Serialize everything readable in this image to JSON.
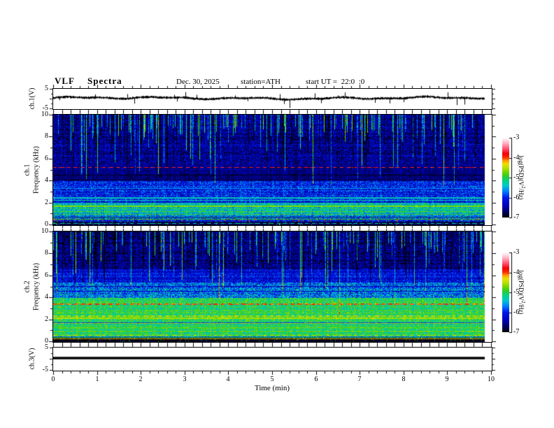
{
  "header": {
    "title": "VLF  Spectra",
    "date": "Dec. 30, 2025",
    "station": "station=ATH",
    "start_ut": "start UT =  22:0  :0"
  },
  "axes": {
    "time": {
      "label": "Time  (min)",
      "min": 0,
      "max": 10,
      "major_ticks": [
        0,
        1,
        2,
        3,
        4,
        5,
        6,
        7,
        8,
        9,
        10
      ],
      "minor_step": 0.2,
      "data_end_min": 9.85
    },
    "wave1": {
      "label": "ch.1(V)",
      "min": -5,
      "max": 5,
      "tick_labels": [
        5,
        -5
      ]
    },
    "spec1": {
      "label_channel": "ch.1",
      "label_axis": "Frequency  (kHz)",
      "min": 0,
      "max": 10,
      "tick_labels": [
        10,
        8,
        6,
        4,
        2,
        0
      ]
    },
    "spec2": {
      "label_channel": "ch.2",
      "label_axis": "Frequency  (kHz)",
      "min": 0,
      "max": 10,
      "tick_labels": [
        10,
        8,
        6,
        4,
        2,
        0
      ]
    },
    "wave3": {
      "label": "ch.3(V)",
      "min": -5,
      "max": 5,
      "tick_labels": [
        5,
        -5
      ]
    }
  },
  "colorbar": {
    "label_prefix": "log(PSD)(V",
    "label_sup": "2",
    "label_suffix": "/Hz)",
    "min": -7,
    "max": -3,
    "tick_labels": [
      -3,
      -4,
      -5,
      -6,
      -7
    ],
    "stops": [
      [
        0,
        "#000000"
      ],
      [
        0.07,
        "#00005e"
      ],
      [
        0.15,
        "#0000bb"
      ],
      [
        0.25,
        "#0018e8"
      ],
      [
        0.33,
        "#0080ff"
      ],
      [
        0.4,
        "#00c8cc"
      ],
      [
        0.46,
        "#00d284"
      ],
      [
        0.52,
        "#30cc2a"
      ],
      [
        0.56,
        "#66d400"
      ],
      [
        0.62,
        "#b4e000"
      ],
      [
        0.67,
        "#ecdf00"
      ],
      [
        0.71,
        "#ffa000"
      ],
      [
        0.75,
        "#ff3000"
      ],
      [
        0.8,
        "#f00000"
      ],
      [
        0.86,
        "#ff4e6e"
      ],
      [
        0.93,
        "#ffb0c2"
      ],
      [
        1,
        "#ffffff"
      ]
    ]
  },
  "chart_data": [
    {
      "type": "line",
      "panel": "ch1_waveform",
      "ylabel": "ch.1(V)",
      "ylim": [
        -5,
        5
      ],
      "xlim": [
        0,
        10
      ],
      "x_extent": [
        0,
        9.85
      ],
      "summary": "Continuous noisy broadband voltage trace centered near +0.4 V with dense fuzz of ±1 V and sparse impulsive spikes reaching about -4.5 V and +3 V.",
      "gen": {
        "base": 0.4,
        "fuzz": 0.5,
        "spike_p": 0.022,
        "seed": 7
      }
    },
    {
      "type": "heatmap",
      "panel": "ch1_spectrogram",
      "ylabel": "ch.1 Frequency (kHz)",
      "ylim": [
        0,
        10
      ],
      "xlim": [
        0,
        10
      ],
      "zlabel": "log(PSD)(V2/Hz)",
      "zlim": [
        -7,
        -3
      ],
      "summary": "VLF spectrogram: dark-blue 5.5-10 kHz band crossed by dense bright cyan-green vertical sferic streaks; very dark band 4-5.5 kHz with a faint purple-red line near 5.25 kHz; blue with cyan speckle 2-4 kHz; green-cyan horizontal banding below 2 kHz; black band below 0.3 kHz.",
      "gen": {
        "seed": 11,
        "bright_p": 0.22,
        "dark_p": 0.18,
        "row_noise": 0.13,
        "bands": [
          [
            5.5,
            10.01,
            -6.5,
            0.45
          ],
          [
            4.0,
            5.5,
            -6.6,
            0.3
          ],
          [
            2.0,
            4.0,
            -6.05,
            0.5
          ],
          [
            1.1,
            2.0,
            -5.3,
            0.45
          ],
          [
            0.6,
            1.1,
            -5.55,
            0.5
          ],
          [
            0.3,
            0.6,
            -6.1,
            0.6,
            0.05,
            -3.9
          ],
          [
            -0.01,
            0.3,
            -6.85,
            0.3,
            0.03,
            -5.0
          ]
        ],
        "lines": [
          [
            5.25,
            -3.8,
            1,
            1
          ],
          [
            4.55,
            -6.9,
            1
          ],
          [
            4.15,
            -6.85,
            1
          ],
          [
            3.3,
            -5.6,
            1
          ],
          [
            2.45,
            -5.35,
            2
          ],
          [
            2.2,
            -5.3,
            1
          ],
          [
            1.7,
            -4.7,
            2
          ],
          [
            1.45,
            -5.0,
            1
          ],
          [
            1.2,
            -4.9,
            1
          ],
          [
            0.95,
            -4.9,
            1
          ],
          [
            0.72,
            -6.6,
            1
          ],
          [
            0.5,
            -4.9,
            1
          ],
          [
            0.15,
            -5.2,
            1,
            1
          ]
        ]
      }
    },
    {
      "type": "heatmap",
      "panel": "ch2_spectrogram",
      "ylabel": "ch.2 Frequency (kHz)",
      "ylim": [
        0,
        10
      ],
      "xlim": [
        0,
        10
      ],
      "zlabel": "log(PSD)(V2/Hz)",
      "zlim": [
        -7,
        -3
      ],
      "summary": "VLF spectrogram: dark-blue 6.6-10 kHz band with cyan sferic streaks; blue 5.4-6.6 kHz; mixed blue-green 4-5.4 kHz; bright green below 4 kHz with a red dashed line near 3.4 kHz, yellow bands near 2.2 kHz and 0.6-1 kHz, dark olive lines, thin red line near 0.25 kHz over a black bottom band.",
      "gen": {
        "seed": 23,
        "bright_p": 0.18,
        "dark_p": 0.15,
        "row_noise": 0.14,
        "bands": [
          [
            6.6,
            10.01,
            -6.6,
            0.45
          ],
          [
            5.4,
            6.6,
            -6.15,
            0.4
          ],
          [
            4.0,
            5.4,
            -5.7,
            0.55,
            0.03,
            -6.8
          ],
          [
            0.35,
            4.0,
            -5.05,
            0.4
          ],
          [
            -0.01,
            0.35,
            -6.9,
            0.25,
            0.02,
            -5.0
          ]
        ],
        "lines": [
          [
            5.05,
            -6.4,
            1
          ],
          [
            4.6,
            -6.3,
            1
          ],
          [
            3.42,
            -4.0,
            2,
            1
          ],
          [
            2.8,
            -4.8,
            1
          ],
          [
            2.3,
            -4.5,
            2,
            1
          ],
          [
            2.15,
            -4.55,
            2
          ],
          [
            1.75,
            -5.9,
            1
          ],
          [
            1.65,
            -4.6,
            1
          ],
          [
            1.3,
            -4.8,
            1
          ],
          [
            0.95,
            -4.7,
            1
          ],
          [
            0.6,
            -4.5,
            1,
            1
          ],
          [
            0.45,
            -5.8,
            1
          ],
          [
            0.25,
            -4.3,
            1
          ]
        ]
      }
    },
    {
      "type": "line",
      "panel": "ch3_waveform",
      "ylabel": "ch.3(V)",
      "ylim": [
        -5,
        5
      ],
      "xlim": [
        0,
        10
      ],
      "x_extent": [
        0,
        9.85
      ],
      "summary": "Flat thick black trace at about +0.5 V for the whole record (inactive channel).",
      "gen": {
        "base": 0.45,
        "thick": 3.5
      }
    }
  ]
}
